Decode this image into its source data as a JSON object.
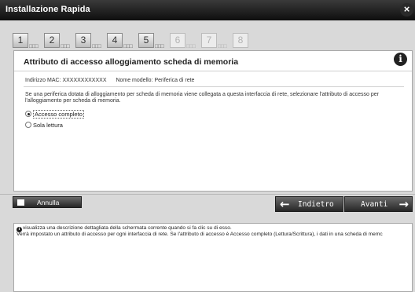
{
  "window": {
    "title": "Installazione Rapida"
  },
  "steps": [
    "1",
    "2",
    "3",
    "4",
    "5",
    "6",
    "7",
    "8"
  ],
  "panel": {
    "title": "Attributo di accesso alloggiamento scheda di memoria",
    "mac_label": "Indirizzo MAC: XXXXXXXXXXXX",
    "model_label": "Nome modello: Periferica di rete",
    "description_1": "Se una periferica dotata di alloggiamento per scheda di memoria viene collegata a questa interfaccia di rete, selezionare l'attributo di accesso per",
    "description_2": "l'alloggiamento per scheda di memoria.",
    "options": [
      {
        "label": "Accesso completo",
        "selected": true
      },
      {
        "label": "Sola lettura",
        "selected": false
      }
    ]
  },
  "buttons": {
    "cancel": "Annulla",
    "back": "Indietro",
    "next": "Avanti"
  },
  "help": {
    "line_1": "visualizza una descrizione dettagliata della schermata corrente quando si fa clic su di esso.",
    "line_2": "Verrà impostato un attributo di accesso per ogni interfaccia di rete. Se l'attributo di accesso è Accesso completo (Lettura/Scrittura), i dati in una scheda di memc"
  }
}
